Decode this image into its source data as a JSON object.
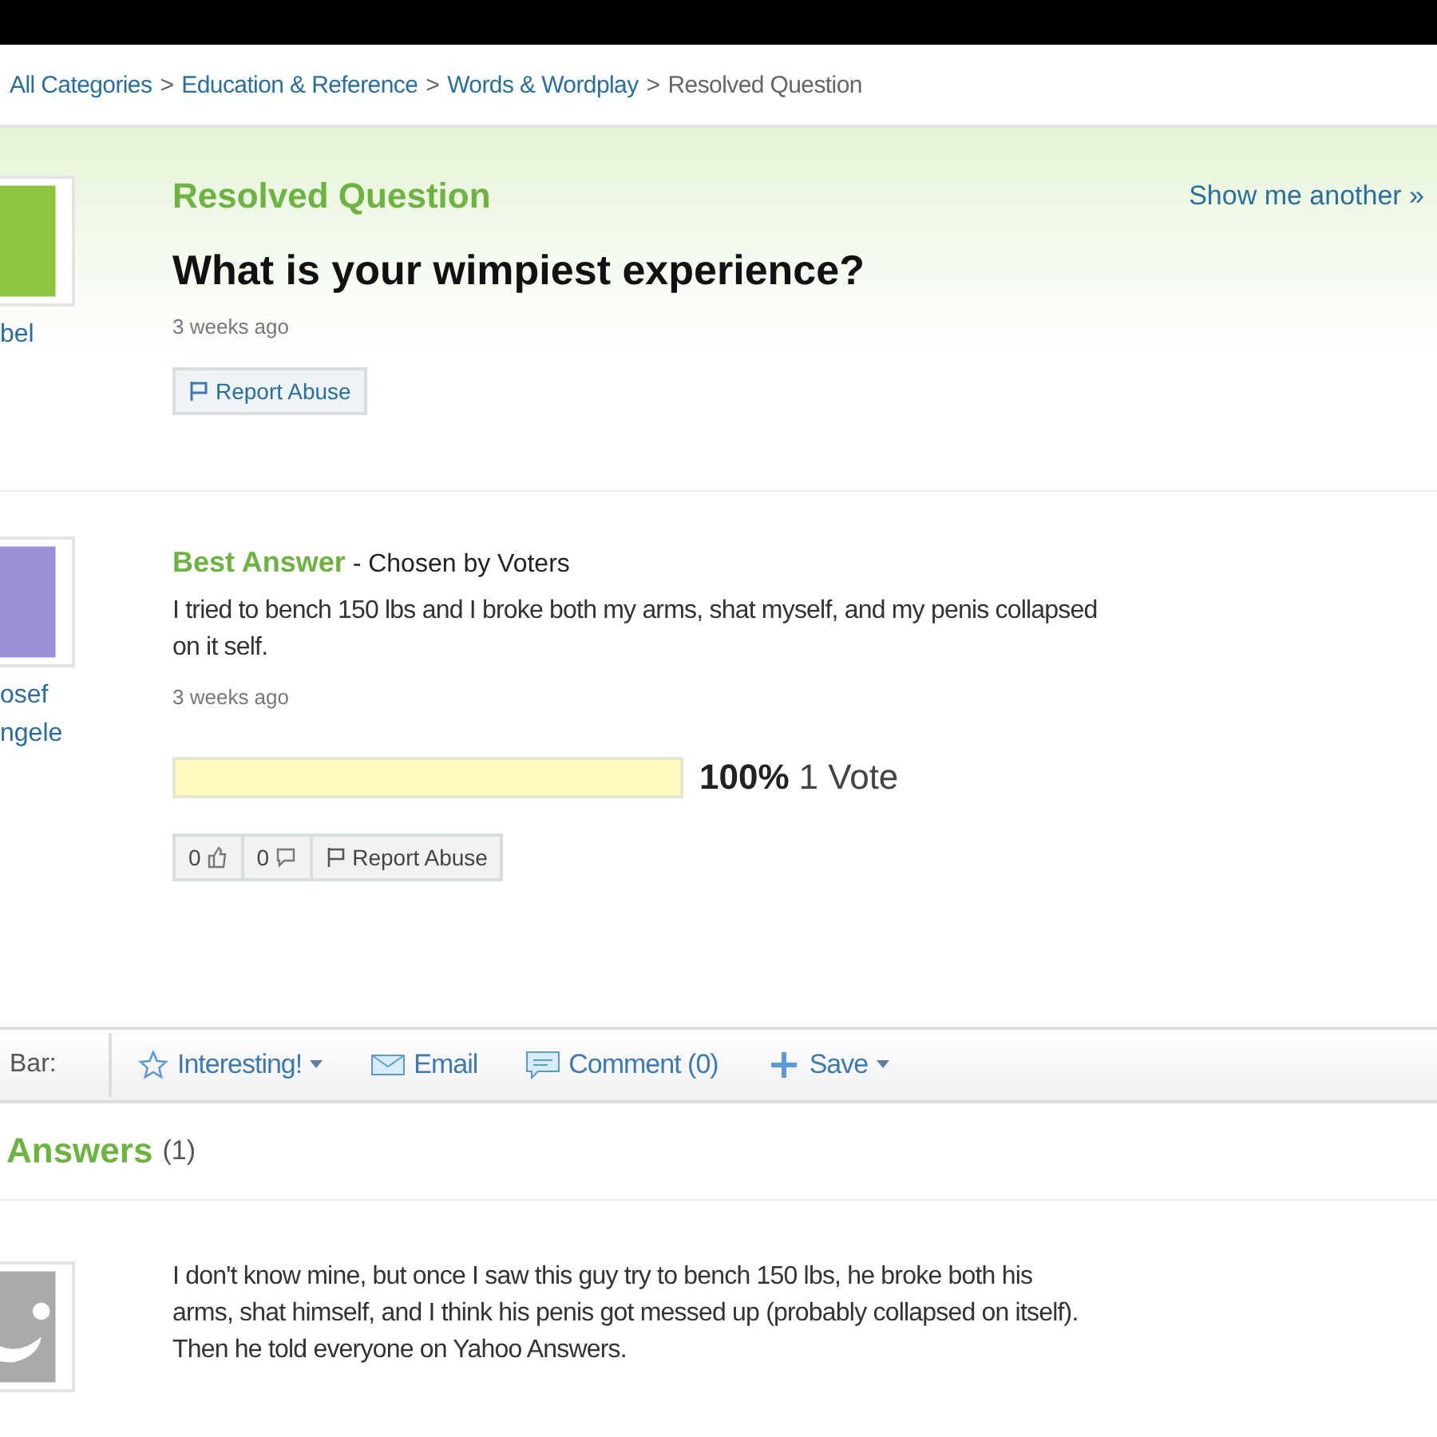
{
  "breadcrumb_separator": ">",
  "breadcrumb": [
    {
      "label": "All Categories"
    },
    {
      "label": "Education & Reference"
    },
    {
      "label": "Words & Wordplay"
    },
    {
      "label": "Resolved Question",
      "current": true
    }
  ],
  "question": {
    "asker": "bel",
    "status": "Resolved Question",
    "show_another": "Show me another »",
    "title": "What is your wimpiest experience?",
    "time": "3 weeks ago",
    "report": "Report Abuse"
  },
  "best_answer": {
    "answerer": [
      "osef",
      "ngele"
    ],
    "heading": "Best Answer",
    "chosen": " - Chosen by Voters",
    "text": "I tried to bench 150 lbs and I broke both my arms, shat myself, and my penis collapsed\non it self.",
    "time": "3 weeks ago",
    "level": 1,
    "percent": "100%",
    "votes": "1 Vote",
    "thumbs": "0",
    "comments": "0",
    "report": "Report Abuse"
  },
  "toolbar": {
    "label": "Bar:",
    "items": [
      {
        "kind": "star",
        "label": "Interesting!",
        "dropdown": true
      },
      {
        "kind": "mail",
        "label": "Email",
        "dropdown": false
      },
      {
        "kind": "comment",
        "label": "Comment (0)",
        "dropdown": false
      },
      {
        "kind": "save",
        "label": "Save",
        "dropdown": true
      }
    ]
  },
  "answers": {
    "heading": "Answers",
    "count": "(1)",
    "items": [
      {
        "text": "I don't know mine, but once I saw this guy try to bench 150 lbs, he broke both his\narms, shat himself, and I think his penis got messed up (probably collapsed on itself).\nThen he told everyone on Yahoo Answers."
      }
    ]
  }
}
